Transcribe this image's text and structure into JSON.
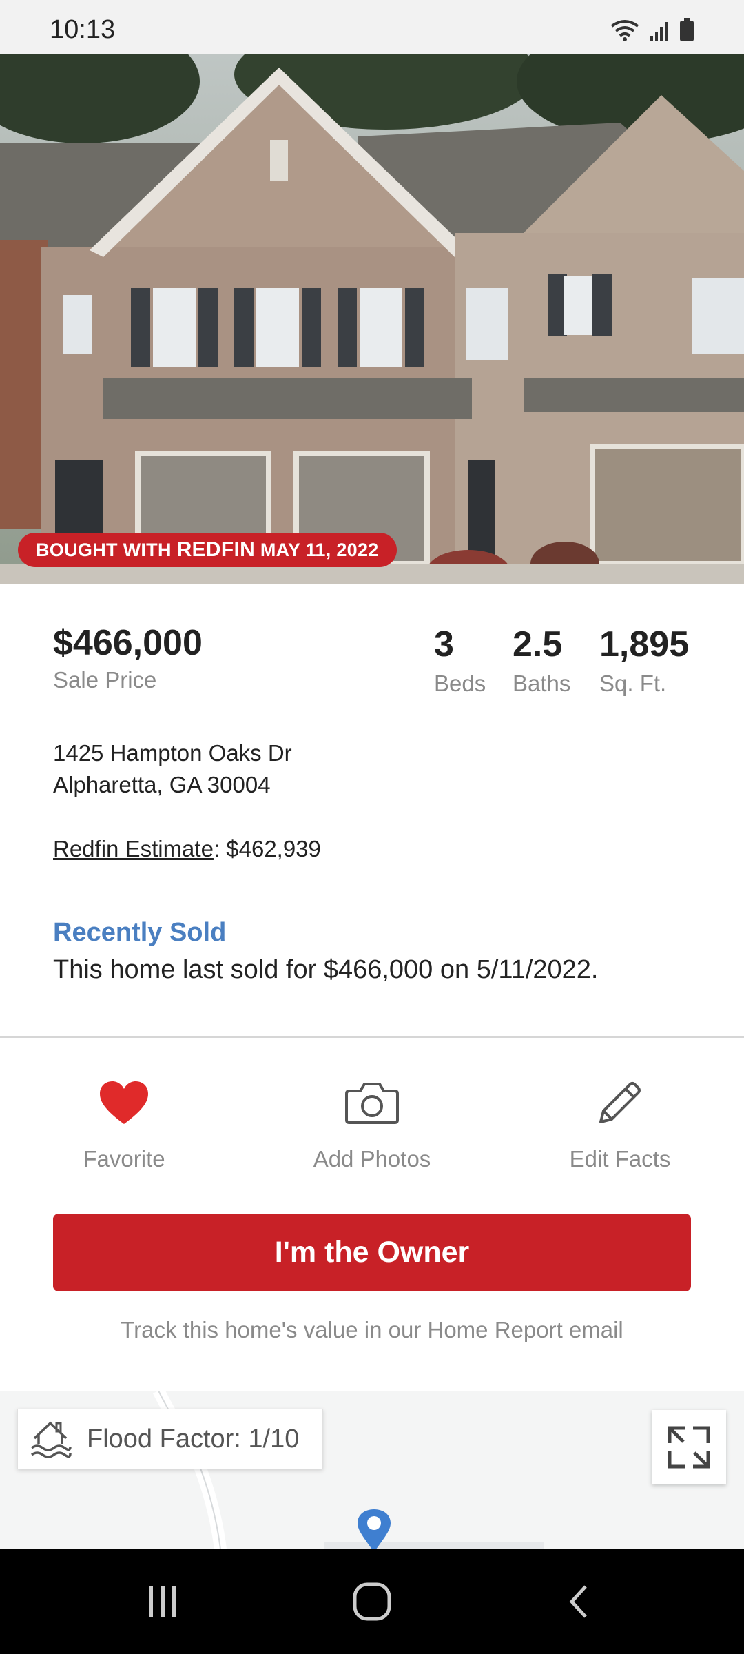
{
  "status_bar": {
    "time": "10:13",
    "icons": [
      "wifi-icon",
      "signal-icon",
      "battery-icon"
    ]
  },
  "hero": {
    "badge_prefix": "BOUGHT WITH ",
    "badge_brand": "REDFIN",
    "badge_date": " MAY 11, 2022"
  },
  "listing": {
    "price": "$466,000",
    "price_label": "Sale Price",
    "beds": "3",
    "beds_label": "Beds",
    "baths": "2.5",
    "baths_label": "Baths",
    "sqft": "1,895",
    "sqft_label": "Sq. Ft.",
    "address_line1": "1425 Hampton Oaks Dr",
    "address_line2": "Alpharetta, GA 30004",
    "estimate_link": "Redfin Estimate",
    "estimate_value": ": $462,939"
  },
  "recently_sold": {
    "title": "Recently Sold",
    "text": "This home last sold for $466,000 on 5/11/2022."
  },
  "actions": {
    "favorite": "Favorite",
    "add_photos": "Add Photos",
    "edit_facts": "Edit Facts"
  },
  "owner_button": "I'm the Owner",
  "track_text": "Track this home's value in our Home Report email",
  "map": {
    "flood_factor": "Flood Factor: 1/10"
  },
  "colors": {
    "brand_red": "#c82127",
    "link_blue": "#4a7fc1",
    "muted_gray": "#8a8a8a"
  }
}
